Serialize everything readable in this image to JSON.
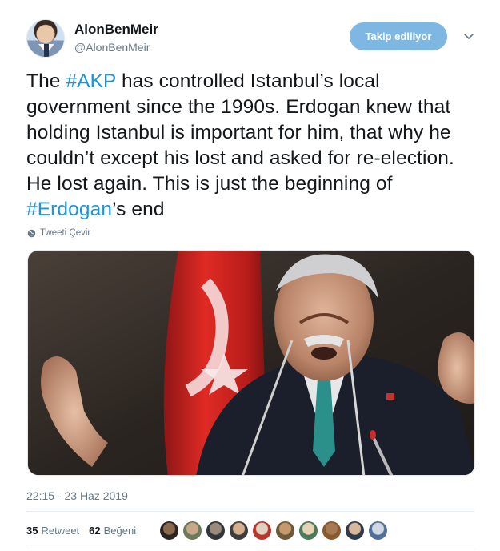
{
  "author": {
    "name": "AlonBenMeir",
    "handle": "@AlonBenMeir"
  },
  "follow_button": {
    "label": "Takip ediliyor"
  },
  "tweet": {
    "segments": [
      "The ",
      "#AKP",
      " has controlled Istanbul’s local government since the 1990s. Erdogan knew that holding Istanbul is important for him, that why he couldn’t except his lost and asked for re-election. He lost again. This is just the beginning of ",
      "#Erdogan",
      "’s end"
    ],
    "translate_label": "Tweeti Çevir",
    "timestamp": "22:15 - 23 Haz 2019"
  },
  "stats": {
    "retweet_count": "35",
    "retweet_label": "Retweet",
    "like_count": "62",
    "like_label": "Beğeni"
  },
  "colors": {
    "link": "#1b95e0",
    "follow_button_bg": "#7fb7e3",
    "secondary_text": "#657786"
  },
  "icons": {
    "chevron": "chevron-down-icon",
    "translate": "globe-icon"
  }
}
